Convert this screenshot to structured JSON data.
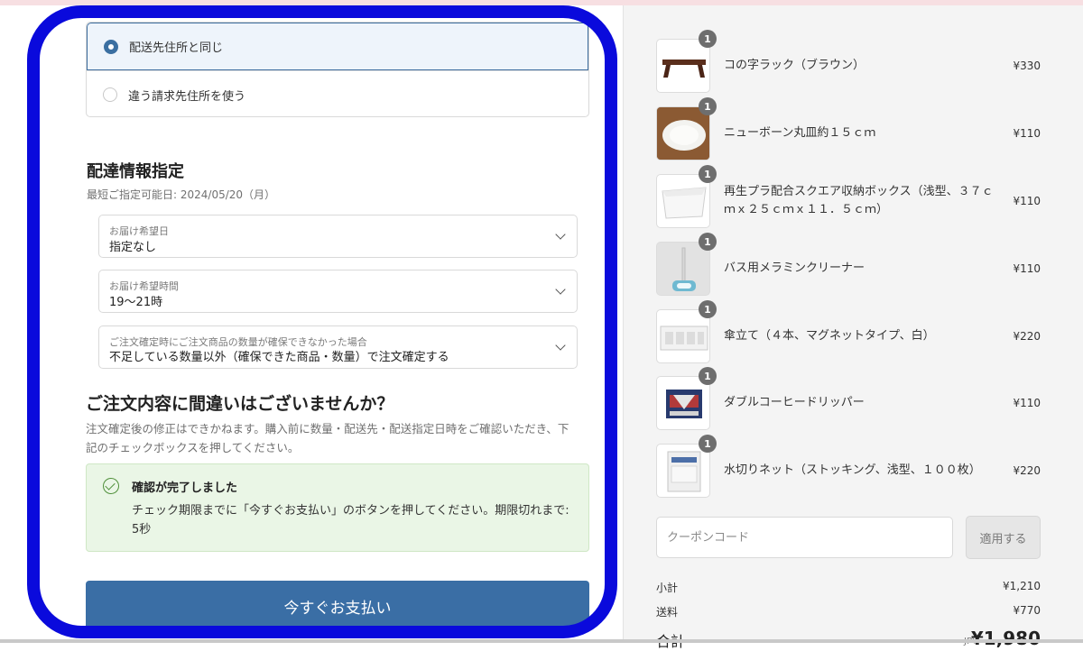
{
  "billing": {
    "option_same": "配送先住所と同じ",
    "option_other": "違う請求先住所を使う"
  },
  "delivery": {
    "title": "配達情報指定",
    "earliest": "最短ご指定可能日: 2024/05/20（月）",
    "date_label": "お届け希望日",
    "date_value": "指定なし",
    "time_label": "お届け希望時間",
    "time_value": "19〜21時",
    "shortage_label": "ご注文確定時にご注文商品の数量が確保できなかった場合",
    "shortage_value": "不足している数量以外（確保できた商品・数量）で注文確定する"
  },
  "confirm": {
    "title": "ご注文内容に間違いはございませんか？",
    "description": "注文確定後の修正はできかねます。購入前に数量・配送先・配送指定日時をご確認いただき、下記のチェックボックスを押してください。",
    "success_title": "確認が完了しました",
    "success_message": "チェック期限までに「今すぐお支払い」のボタンを押してください。期限切れまで: 5秒",
    "pay_button": "今すぐお支払い"
  },
  "cart": {
    "items": [
      {
        "name": "コの字ラック（ブラウン）",
        "price": "¥330",
        "qty": "1"
      },
      {
        "name": "ニューボーン丸皿約１５ｃｍ",
        "price": "¥110",
        "qty": "1"
      },
      {
        "name": "再生プラ配合スクエア収納ボックス（浅型、３７ｃｍｘ２５ｃｍｘ１１．５ｃｍ）",
        "price": "¥110",
        "qty": "1"
      },
      {
        "name": "バス用メラミンクリーナー",
        "price": "¥110",
        "qty": "1"
      },
      {
        "name": "傘立て（４本、マグネットタイプ、白）",
        "price": "¥220",
        "qty": "1"
      },
      {
        "name": "ダブルコーヒードリッパー",
        "price": "¥110",
        "qty": "1"
      },
      {
        "name": "水切りネット（ストッキング、浅型、１００枚）",
        "price": "¥220",
        "qty": "1"
      }
    ],
    "coupon_placeholder": "クーポンコード",
    "apply_label": "適用する",
    "subtotal_label": "小計",
    "subtotal": "¥1,210",
    "shipping_label": "送料",
    "shipping": "¥770",
    "total_label": "合計",
    "currency": "JPY",
    "total": "¥1,980"
  },
  "colors": {
    "accent": "#3a6ea5",
    "annotation": "#0a0adc",
    "success_bg": "#eaf6e6"
  }
}
